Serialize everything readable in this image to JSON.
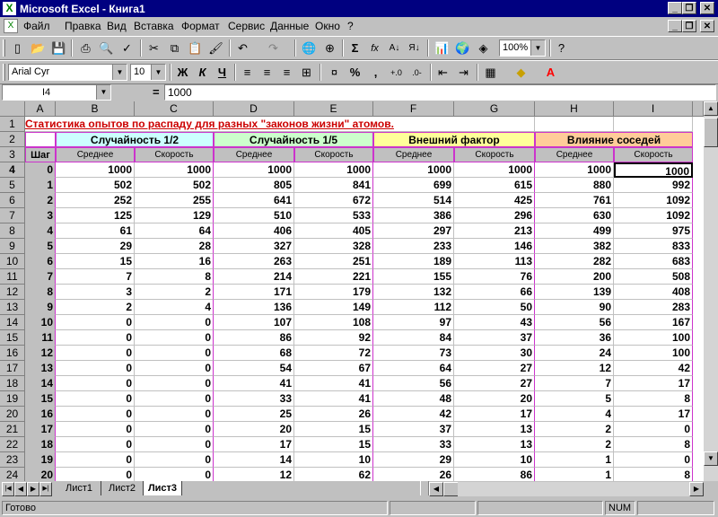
{
  "window": {
    "title": "Microsoft Excel - Книга1"
  },
  "menu": [
    "Файл",
    "Правка",
    "Вид",
    "Вставка",
    "Формат",
    "Сервис",
    "Данные",
    "Окно",
    "?"
  ],
  "toolbar": {
    "zoom": "100%",
    "font_name": "Arial Cyr",
    "font_size": "10",
    "bold": "Ж",
    "italic": "К",
    "underline": "Ч",
    "percent": "%",
    "comma": ","
  },
  "formula_bar": {
    "cell_ref": "I4",
    "eq": "=",
    "value": "1000"
  },
  "columns": [
    "A",
    "B",
    "C",
    "D",
    "E",
    "F",
    "G",
    "H",
    "I"
  ],
  "sheet": {
    "title_text": "Статистика опытов по распаду для разных \"законов жизни\" атомов.",
    "groups": [
      "Случайность 1/2",
      "Случайность 1/5",
      "Внешний фактор",
      "Влияние соседей"
    ],
    "group_colors": [
      "#ccffff",
      "#ccffcc",
      "#ffff99",
      "#ffcc99"
    ],
    "step_label": "Шаг",
    "sub_labels": [
      "Среднее",
      "Скорость"
    ],
    "rows": [
      [
        0,
        1000,
        1000,
        1000,
        1000,
        1000,
        1000,
        1000,
        1000
      ],
      [
        1,
        502,
        502,
        805,
        841,
        699,
        615,
        880,
        992
      ],
      [
        2,
        252,
        255,
        641,
        672,
        514,
        425,
        761,
        1092
      ],
      [
        3,
        125,
        129,
        510,
        533,
        386,
        296,
        630,
        1092
      ],
      [
        4,
        61,
        64,
        406,
        405,
        297,
        213,
        499,
        975
      ],
      [
        5,
        29,
        28,
        327,
        328,
        233,
        146,
        382,
        833
      ],
      [
        6,
        15,
        16,
        263,
        251,
        189,
        113,
        282,
        683
      ],
      [
        7,
        7,
        8,
        214,
        221,
        155,
        76,
        200,
        508
      ],
      [
        8,
        3,
        2,
        171,
        179,
        132,
        66,
        139,
        408
      ],
      [
        9,
        2,
        4,
        136,
        149,
        112,
        50,
        90,
        283
      ],
      [
        10,
        0,
        0,
        107,
        108,
        97,
        43,
        56,
        167
      ],
      [
        11,
        0,
        0,
        86,
        92,
        84,
        37,
        36,
        100
      ],
      [
        12,
        0,
        0,
        68,
        72,
        73,
        30,
        24,
        100
      ],
      [
        13,
        0,
        0,
        54,
        67,
        64,
        27,
        12,
        42
      ],
      [
        14,
        0,
        0,
        41,
        41,
        56,
        27,
        7,
        17
      ],
      [
        15,
        0,
        0,
        33,
        41,
        48,
        20,
        5,
        8
      ],
      [
        16,
        0,
        0,
        25,
        26,
        42,
        17,
        4,
        17
      ],
      [
        17,
        0,
        0,
        20,
        15,
        37,
        13,
        2,
        0
      ],
      [
        18,
        0,
        0,
        17,
        15,
        33,
        13,
        2,
        8
      ],
      [
        19,
        0,
        0,
        14,
        10,
        29,
        10,
        1,
        0
      ],
      [
        20,
        0,
        0,
        12,
        62,
        26,
        86,
        1,
        8
      ]
    ]
  },
  "sheet_tabs": [
    "Лист1",
    "Лист2",
    "Лист3"
  ],
  "active_tab": "Лист3",
  "status": {
    "ready": "Готово",
    "num": "NUM"
  }
}
